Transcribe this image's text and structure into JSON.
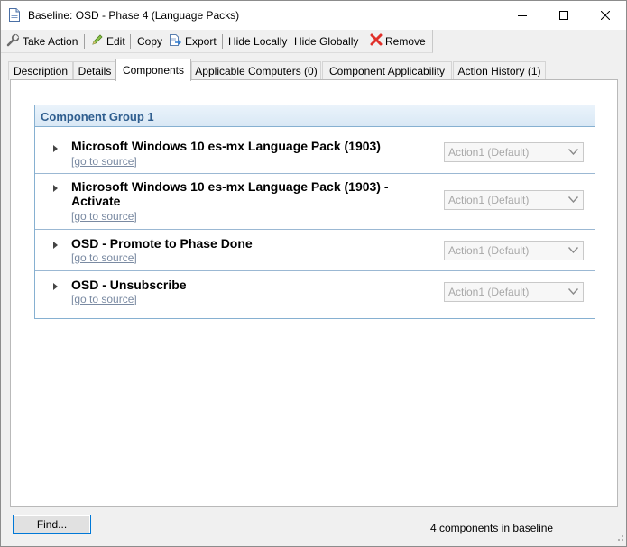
{
  "window": {
    "title": "Baseline: OSD - Phase 4 (Language Packs)",
    "minimize_icon": "minimize-icon",
    "maximize_icon": "maximize-icon",
    "close_icon": "close-icon"
  },
  "toolbar": {
    "take_action": "Take Action",
    "edit": "Edit",
    "copy": "Copy",
    "export": "Export",
    "hide_locally": "Hide Locally",
    "hide_globally": "Hide Globally",
    "remove": "Remove"
  },
  "tabs": [
    {
      "label": "Description"
    },
    {
      "label": "Details"
    },
    {
      "label": "Components",
      "active": true
    },
    {
      "label": "Applicable Computers (0)"
    },
    {
      "label": "Component Applicability"
    },
    {
      "label": "Action History (1)"
    }
  ],
  "group": {
    "title": "Component Group 1",
    "components": [
      {
        "name": "Microsoft Windows 10 es-mx Language Pack (1903)",
        "link": "[go to source]",
        "action": "Action1 (Default)"
      },
      {
        "name": "Microsoft Windows 10 es-mx Language Pack (1903) - Activate",
        "link": "[go to source]",
        "action": "Action1 (Default)"
      },
      {
        "name": "OSD - Promote to Phase Done",
        "link": "[go to source]",
        "action": "Action1 (Default)"
      },
      {
        "name": "OSD - Unsubscribe",
        "link": "[go to source]",
        "action": "Action1 (Default)"
      }
    ]
  },
  "footer": {
    "find_button": "Find...",
    "status": "4 components in baseline"
  },
  "colors": {
    "group_header_text": "#2f5e8f",
    "group_border": "#86b0d1",
    "link": "#7a8aa2",
    "remove_icon": "#e0302a"
  }
}
